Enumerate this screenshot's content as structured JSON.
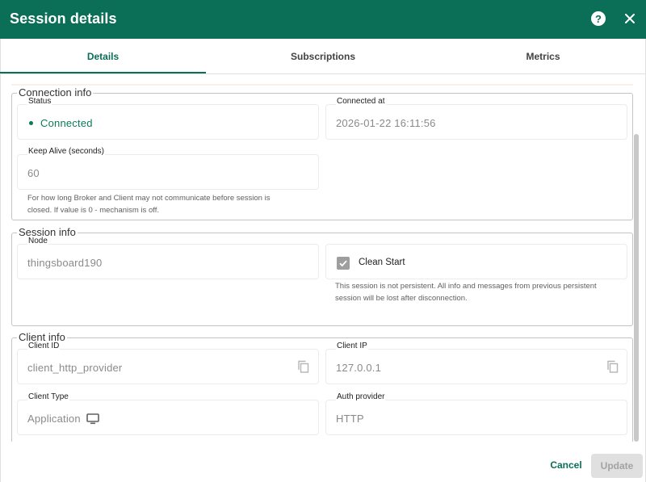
{
  "dialog": {
    "title": "Session details"
  },
  "tabs": [
    {
      "label": "Details",
      "active": true
    },
    {
      "label": "Subscriptions",
      "active": false
    },
    {
      "label": "Metrics",
      "active": false
    }
  ],
  "connection_info": {
    "legend": "Connection info",
    "status": {
      "label": "Status",
      "value": "Connected"
    },
    "connected_at": {
      "label": "Connected at",
      "value": "2026-01-22 16:11:56"
    },
    "keep_alive": {
      "label": "Keep Alive (seconds)",
      "value": "60"
    },
    "keep_alive_hint_line1": "For how long Broker and Client may not communicate before session is",
    "keep_alive_hint_line2": "closed. If value is 0 - mechanism is off."
  },
  "session_info": {
    "legend": "Session info",
    "node": {
      "label": "Node",
      "value": "thingsboard190"
    },
    "clean_start": {
      "label": "Clean Start",
      "checked": true
    },
    "clean_start_hint_line1": "This session is not persistent. All info and messages from previous persistent",
    "clean_start_hint_line2": "session will be lost after disconnection."
  },
  "client_info": {
    "legend": "Client info",
    "client_id": {
      "label": "Client ID",
      "value": "client_http_provider"
    },
    "client_ip": {
      "label": "Client IP",
      "value": "127.0.0.1"
    },
    "client_type": {
      "label": "Client Type",
      "value": "Application",
      "icon": "monitor-icon"
    },
    "auth_provider": {
      "label": "Auth provider",
      "value": "HTTP"
    }
  },
  "footer": {
    "cancel_label": "Cancel",
    "update_label": "Update"
  },
  "colors": {
    "primary": "#0b6e57",
    "status_connected": "#0b7a58",
    "disabled_button": "#e0e0e0"
  }
}
